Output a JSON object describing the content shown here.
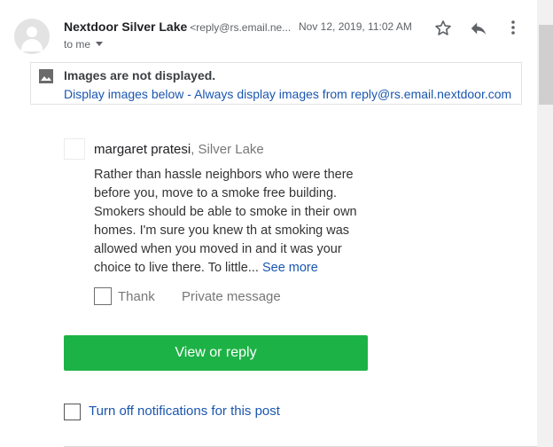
{
  "header": {
    "sender_name": "Nextdoor Silver Lake",
    "sender_email": "<reply@rs.email.ne...",
    "date": "Nov 12, 2019, 11:02 AM",
    "recipient": "to me"
  },
  "icons": {
    "avatar": "person-avatar-icon",
    "star": "star-outline-icon",
    "reply": "reply-arrow-icon",
    "more": "more-vert-icon",
    "images": "image-icon"
  },
  "image_banner": {
    "title": "Images are not displayed.",
    "display_below": "Display images below",
    "separator": " - ",
    "always_display": "Always display images from reply@rs.email.nextdoor.com"
  },
  "post": {
    "author": "margaret pratesi",
    "location": ", Silver Lake",
    "text": "Rather than hassle neighbors who were there before you, move to a smoke free building. Smokers should be able to smoke in their own homes. I'm sure you knew th at smoking was allowed when you moved in and it was your choice to live there. To little...",
    "see_more": "See more",
    "thank_label": "Thank",
    "private_message": "Private message"
  },
  "view_button": "View or reply",
  "notifications_link": "Turn off notifications for this post",
  "colors": {
    "link": "#1a56b0",
    "button_green": "#1db246"
  }
}
